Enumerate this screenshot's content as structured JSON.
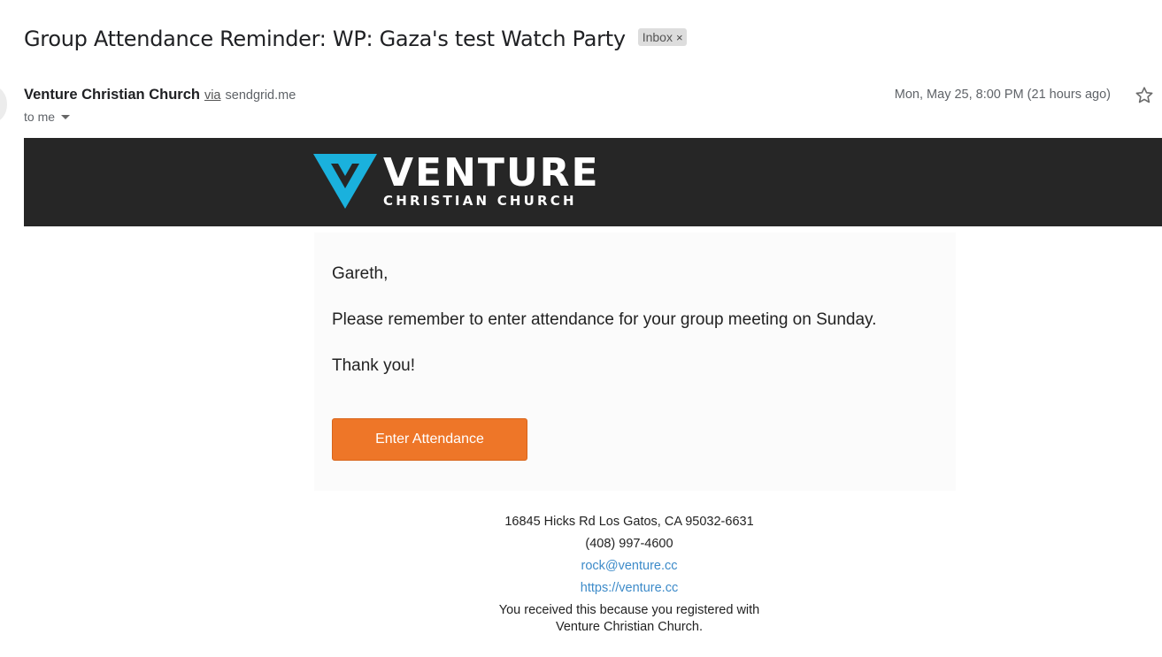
{
  "email": {
    "subject": "Group Attendance Reminder: WP: Gaza's test Watch Party",
    "label": "Inbox",
    "label_close": "×",
    "sender_name": "Venture Christian Church",
    "via_label": "via",
    "via_domain": "sendgrid.me",
    "to_label": "to me",
    "date": "Mon, May 25, 8:00 PM (21 hours ago)"
  },
  "banner": {
    "logo_word": "VENTURE",
    "logo_sub": "CHRISTIAN CHURCH",
    "mark_color": "#1ab1dd",
    "background": "#262626"
  },
  "message": {
    "greeting": "Gareth,",
    "line1": "Please remember to enter attendance for your group meeting on Sunday.",
    "thanks": "Thank you!",
    "button_label": "Enter Attendance",
    "button_color": "#ee7628"
  },
  "footer": {
    "address": "16845 Hicks Rd Los Gatos, CA 95032-6631",
    "phone": "(408) 997-4600",
    "email": "rock@venture.cc",
    "website": "https://venture.cc",
    "note_line1": "You received this because you registered with",
    "note_line2": "Venture Christian Church."
  },
  "icons": {
    "star": "star-outline-icon",
    "caret": "caret-down-icon",
    "logo": "venture-v-logo-icon"
  }
}
